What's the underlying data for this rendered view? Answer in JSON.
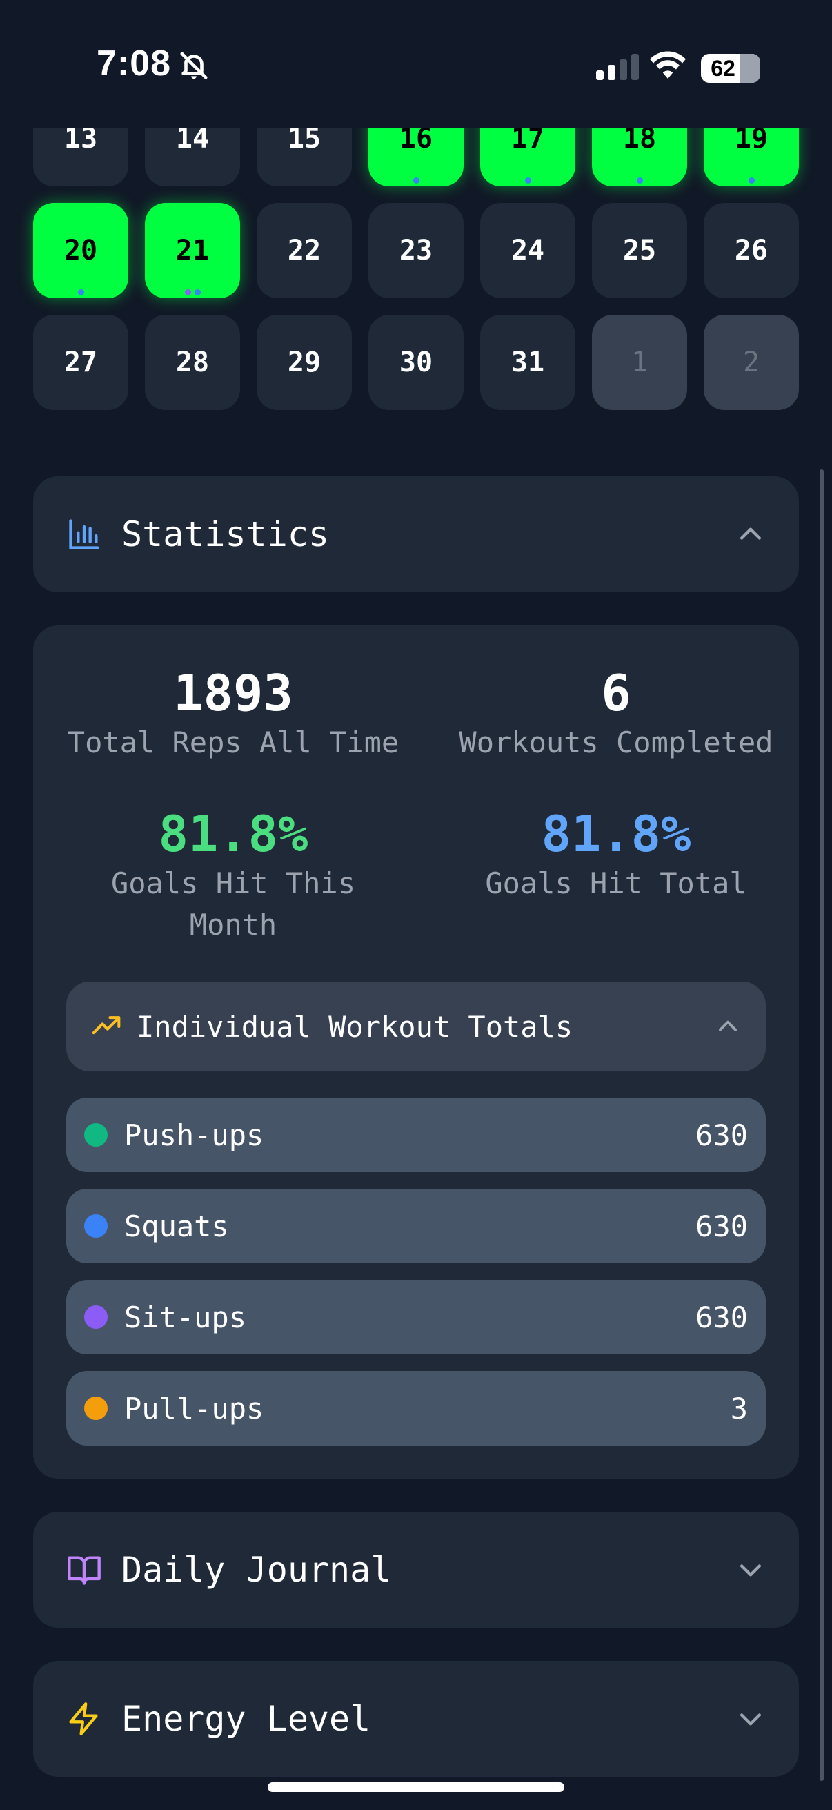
{
  "status_bar": {
    "time": "7:08",
    "battery": "62"
  },
  "calendar": {
    "rows": [
      [
        {
          "d": "13",
          "state": "normal"
        },
        {
          "d": "14",
          "state": "normal"
        },
        {
          "d": "15",
          "state": "normal"
        },
        {
          "d": "16",
          "state": "hit"
        },
        {
          "d": "17",
          "state": "hit"
        },
        {
          "d": "18",
          "state": "hit"
        },
        {
          "d": "19",
          "state": "hit"
        }
      ],
      [
        {
          "d": "20",
          "state": "hit"
        },
        {
          "d": "21",
          "state": "hit"
        },
        {
          "d": "22",
          "state": "normal"
        },
        {
          "d": "23",
          "state": "normal"
        },
        {
          "d": "24",
          "state": "normal"
        },
        {
          "d": "25",
          "state": "normal"
        },
        {
          "d": "26",
          "state": "normal"
        }
      ],
      [
        {
          "d": "27",
          "state": "normal"
        },
        {
          "d": "28",
          "state": "normal"
        },
        {
          "d": "29",
          "state": "normal"
        },
        {
          "d": "30",
          "state": "normal"
        },
        {
          "d": "31",
          "state": "normal"
        },
        {
          "d": "1",
          "state": "other-month"
        },
        {
          "d": "2",
          "state": "other-month"
        }
      ]
    ]
  },
  "statistics": {
    "title": "Statistics",
    "total_reps": {
      "value": "1893",
      "label": "Total Reps All Time"
    },
    "workouts": {
      "value": "6",
      "label": "Workouts Completed"
    },
    "goals_month": {
      "value": "81.8%",
      "label_line1": "Goals Hit This",
      "label_line2": "Month"
    },
    "goals_total": {
      "value": "81.8%",
      "label": "Goals Hit Total"
    },
    "individual": {
      "title": "Individual Workout Totals",
      "items": [
        {
          "name": "Push-ups",
          "value": "630",
          "color": "#10b981"
        },
        {
          "name": "Squats",
          "value": "630",
          "color": "#3b82f6"
        },
        {
          "name": "Sit-ups",
          "value": "630",
          "color": "#8b5cf6"
        },
        {
          "name": "Pull-ups",
          "value": "3",
          "color": "#f59e0b"
        }
      ]
    }
  },
  "journal": {
    "title": "Daily Journal"
  },
  "energy": {
    "title": "Energy Level"
  },
  "colors": {
    "hit": "#00ff41",
    "accent_green": "#4ade80",
    "accent_blue": "#60a5fa",
    "card": "#1f2937",
    "background": "#111827"
  }
}
